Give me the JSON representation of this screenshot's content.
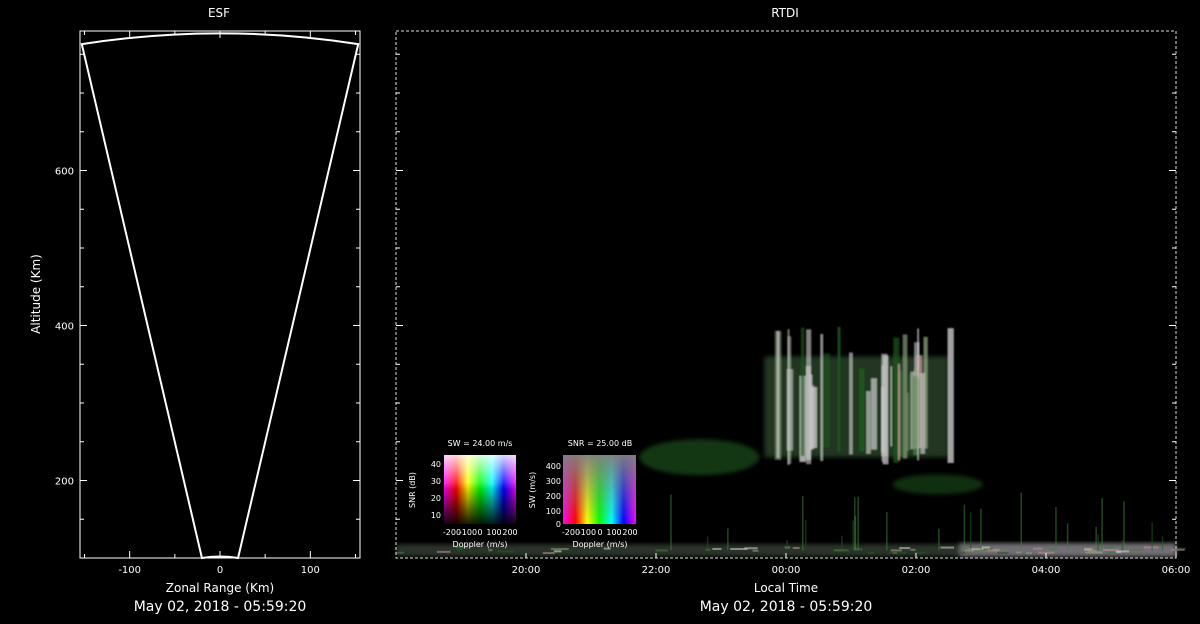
{
  "chart_data": [
    {
      "type": "scatter",
      "panel": "esf",
      "title": "ESF",
      "xlabel": "Zonal Range (Km)",
      "ylabel": "Altitude (Km)",
      "date_label": "May 02, 2018 - 05:59:20",
      "xlim": [
        -155,
        155
      ],
      "ylim": [
        100,
        780
      ],
      "x_ticks": [
        -100,
        0,
        100
      ],
      "y_ticks": [
        200,
        400,
        600
      ],
      "outline_color": "#ffffff",
      "background": "#000000",
      "fan_outline": [
        {
          "x": -20,
          "y": 100
        },
        {
          "x": -153,
          "y": 763
        },
        {
          "x": 0,
          "y": 778
        },
        {
          "x": 153,
          "y": 763
        },
        {
          "x": 20,
          "y": 100
        }
      ]
    },
    {
      "type": "heatmap",
      "panel": "rtdi",
      "title": "RTDI",
      "xlabel": "Local Time",
      "date_label": "May 02, 2018 - 05:59:20",
      "xlim": [
        "18:00",
        "06:00"
      ],
      "ylim": [
        100,
        780
      ],
      "x_ticks": [
        "20:00",
        "22:00",
        "00:00",
        "02:00",
        "04:00",
        "06:00"
      ],
      "echo_colors": [
        "#1f5a1f",
        "#3f7f3a",
        "#c8c8c8",
        "#b89090",
        "#8aa07a"
      ],
      "plume": {
        "time_start": "23:40",
        "time_end": "02:30",
        "alt_bottom": 230,
        "alt_top": 400
      },
      "bottomside_layer_alt": 110
    }
  ],
  "legends": {
    "sw_legend": {
      "title": "SW = 24.00 m/s",
      "ylabel": "SNR (dB)",
      "xlabel": "Doppler (m/s)",
      "y_ticks": [
        "40",
        "30",
        "20",
        "10"
      ],
      "x_ticks": [
        "-200",
        "-100",
        "0",
        "100",
        "200"
      ]
    },
    "snr_legend": {
      "title": "SNR = 25.00 dB",
      "ylabel": "SW (m/s)",
      "xlabel": "Doppler (m/s)",
      "y_ticks": [
        "400",
        "300",
        "200",
        "100",
        "0"
      ],
      "x_ticks": [
        "-200",
        "-100",
        "0",
        "100",
        "200"
      ]
    }
  }
}
